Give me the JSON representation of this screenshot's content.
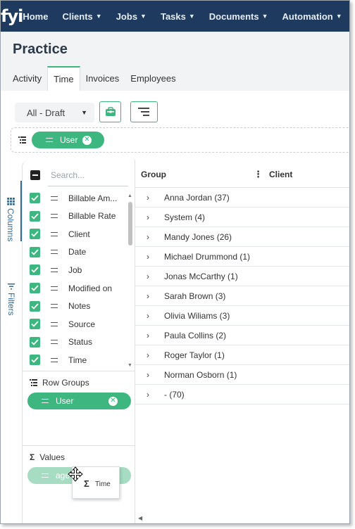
{
  "brand": {
    "logo_text": "fyi",
    "accent": "#3db77f",
    "nav_bg": "#1e3a5f"
  },
  "nav": {
    "items": [
      {
        "label": "Home",
        "dropdown": false
      },
      {
        "label": "Clients",
        "dropdown": true
      },
      {
        "label": "Jobs",
        "dropdown": true
      },
      {
        "label": "Tasks",
        "dropdown": true
      },
      {
        "label": "Documents",
        "dropdown": true
      },
      {
        "label": "Automation",
        "dropdown": true
      }
    ]
  },
  "page": {
    "title": "Practice"
  },
  "tabs": [
    {
      "label": "Activity",
      "active": false
    },
    {
      "label": "Time",
      "active": true
    },
    {
      "label": "Invoices",
      "active": false
    },
    {
      "label": "Employees",
      "active": false
    }
  ],
  "toolbar": {
    "view_select": "All - Draft",
    "briefcase_icon": "briefcase-icon",
    "tree_icon": "row-groups-icon"
  },
  "row_group_bar": {
    "pill_label": "User"
  },
  "side_tabs": {
    "columns": "Columns",
    "filters": "Filters"
  },
  "column_panel": {
    "search_placeholder": "Search...",
    "columns": [
      {
        "label": "Billable Am...",
        "checked": true
      },
      {
        "label": "Billable Rate",
        "checked": true
      },
      {
        "label": "Client",
        "checked": true
      },
      {
        "label": "Date",
        "checked": true
      },
      {
        "label": "Job",
        "checked": true
      },
      {
        "label": "Modified on",
        "checked": true
      },
      {
        "label": "Notes",
        "checked": true
      },
      {
        "label": "Source",
        "checked": true
      },
      {
        "label": "Status",
        "checked": true
      },
      {
        "label": "Time",
        "checked": true
      }
    ],
    "row_groups_title": "Row Groups",
    "row_groups_pill": "User",
    "values_title": "Values",
    "values_pill": "age"
  },
  "grid": {
    "headers": {
      "group": "Group",
      "client": "Client"
    },
    "rows": [
      "Anna Jordan (37)",
      "System (4)",
      "Mandy Jones (26)",
      "Michael Drummond (1)",
      "Jonas McCarthy (1)",
      "Sarah Brown (3)",
      "Olivia Wiliams (3)",
      "Paula Collins (2)",
      "Roger Taylor (1)",
      "Norman Osborn (1)",
      "- (70)"
    ]
  },
  "drag_ghost": {
    "symbol": "Σ",
    "label": "Time"
  }
}
